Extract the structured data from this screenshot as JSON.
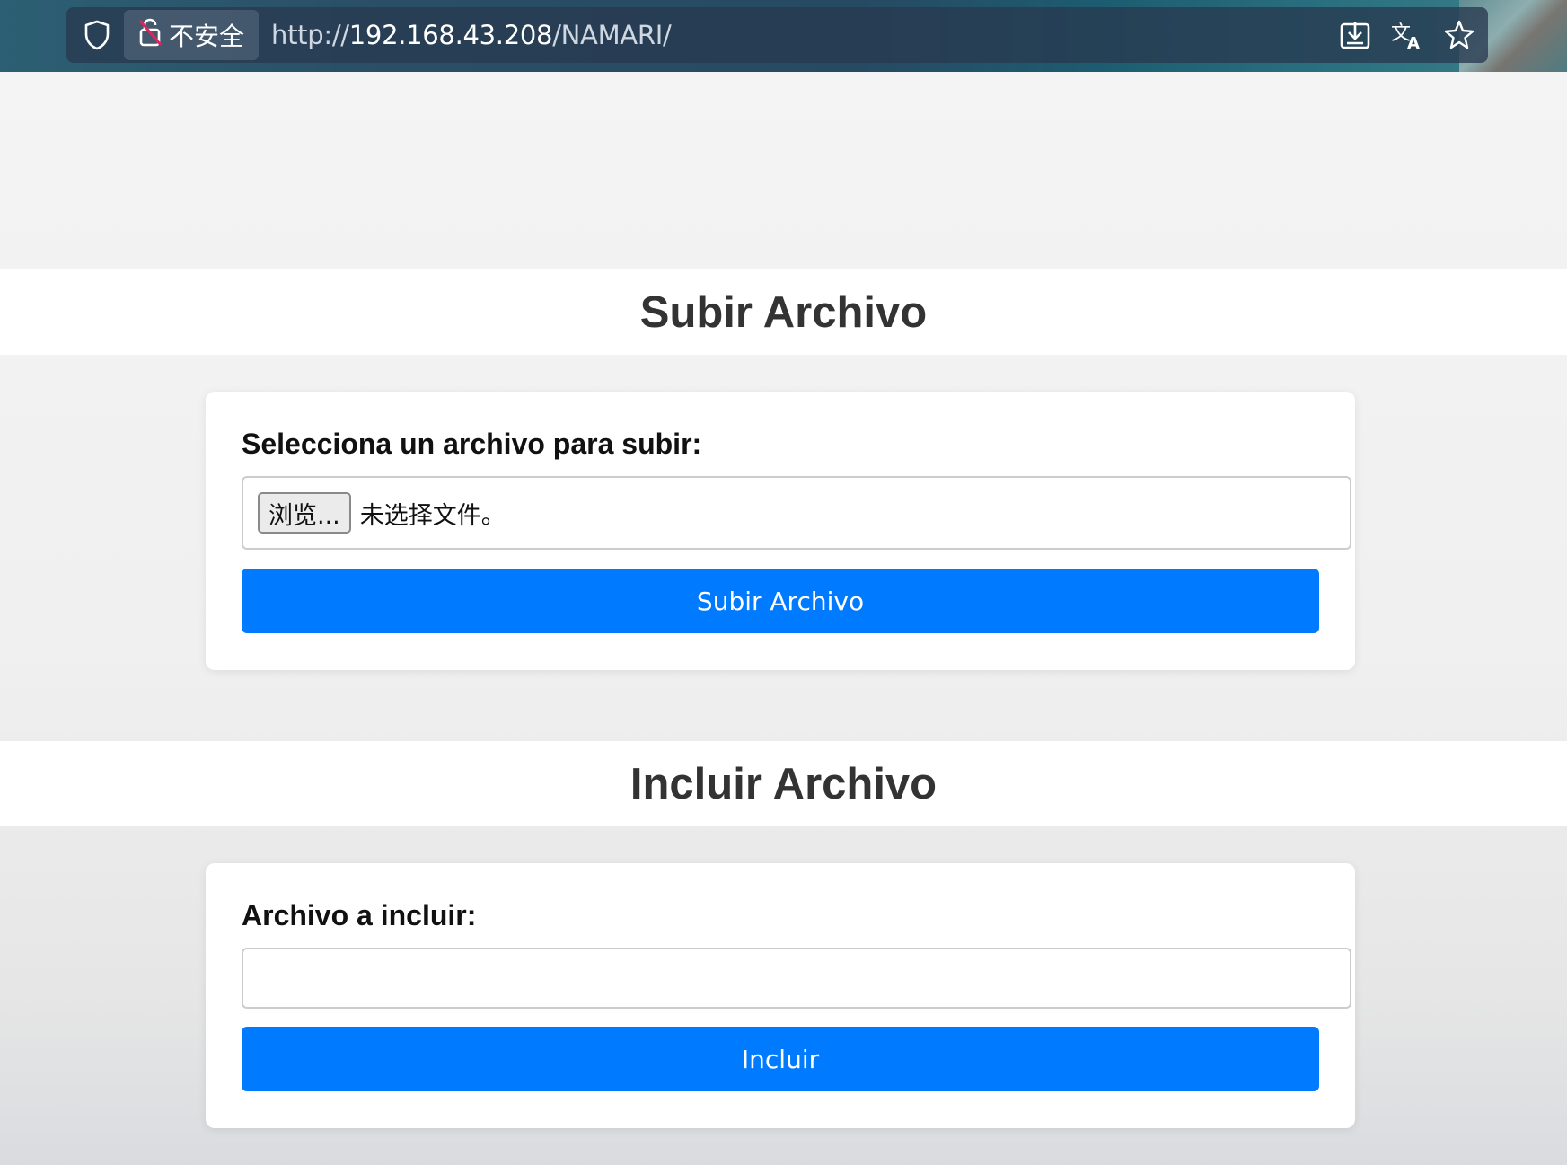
{
  "browser": {
    "security_label": "不安全",
    "url_scheme": "http://",
    "url_host": "192.168.43.208",
    "url_path": "/NAMARI/",
    "icons": {
      "shield": "shield-icon",
      "insecure": "lock-slash-icon",
      "download": "download-icon",
      "translate": "translate-icon",
      "bookmark": "star-icon"
    }
  },
  "upload": {
    "title": "Subir Archivo",
    "label": "Selecciona un archivo para subir:",
    "browse_label": "浏览...",
    "no_file_text": "未选择文件。",
    "submit_label": "Subir Archivo"
  },
  "include": {
    "title": "Incluir Archivo",
    "label": "Archivo a incluir:",
    "input_value": "",
    "submit_label": "Incluir"
  },
  "colors": {
    "primary": "#007bff",
    "heading": "#333333"
  }
}
